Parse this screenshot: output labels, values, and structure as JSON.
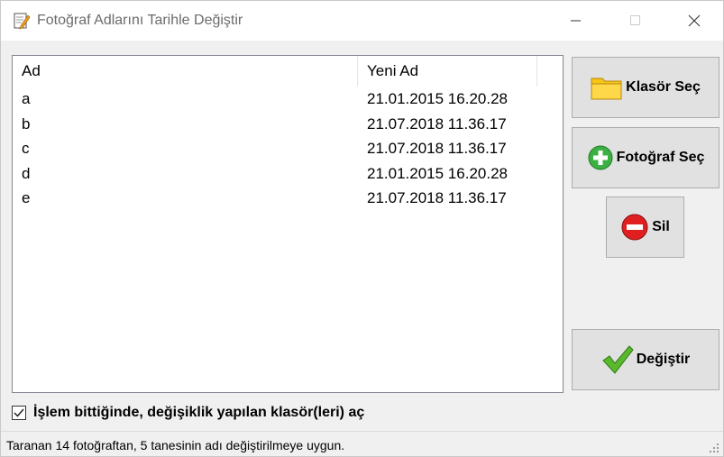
{
  "window": {
    "title": "Fotoğraf Adlarını Tarihle Değiştir",
    "icon": "notepad-pencil-icon"
  },
  "list": {
    "columns": [
      "Ad",
      "Yeni Ad"
    ],
    "rows": [
      {
        "ad": "a",
        "yeni_ad": "21.01.2015 16.20.28"
      },
      {
        "ad": "b",
        "yeni_ad": "21.07.2018 11.36.17"
      },
      {
        "ad": "c",
        "yeni_ad": "21.07.2018 11.36.17"
      },
      {
        "ad": "d",
        "yeni_ad": "21.01.2015 16.20.28"
      },
      {
        "ad": "e",
        "yeni_ad": "21.07.2018 11.36.17"
      }
    ]
  },
  "buttons": {
    "klasor_sec": {
      "label": "Klasör Seç",
      "icon": "folder-icon"
    },
    "fotograf_sec": {
      "label": "Fotoğraf Seç",
      "icon": "plus-circle-icon"
    },
    "sil": {
      "label": "Sil",
      "icon": "minus-circle-icon"
    },
    "degistir": {
      "label": "Değiştir",
      "icon": "checkmark-icon"
    }
  },
  "checkbox": {
    "label": "İşlem bittiğinde, değişiklik yapılan klasör(leri) aç",
    "checked": true
  },
  "status": {
    "text": "Taranan 14 fotoğraftan, 5 tanesinin adı değiştirilmeye uygun."
  },
  "colors": {
    "folder": "#f5c518",
    "add": "#3cb043",
    "remove": "#e02020",
    "check": "#59b82c"
  }
}
